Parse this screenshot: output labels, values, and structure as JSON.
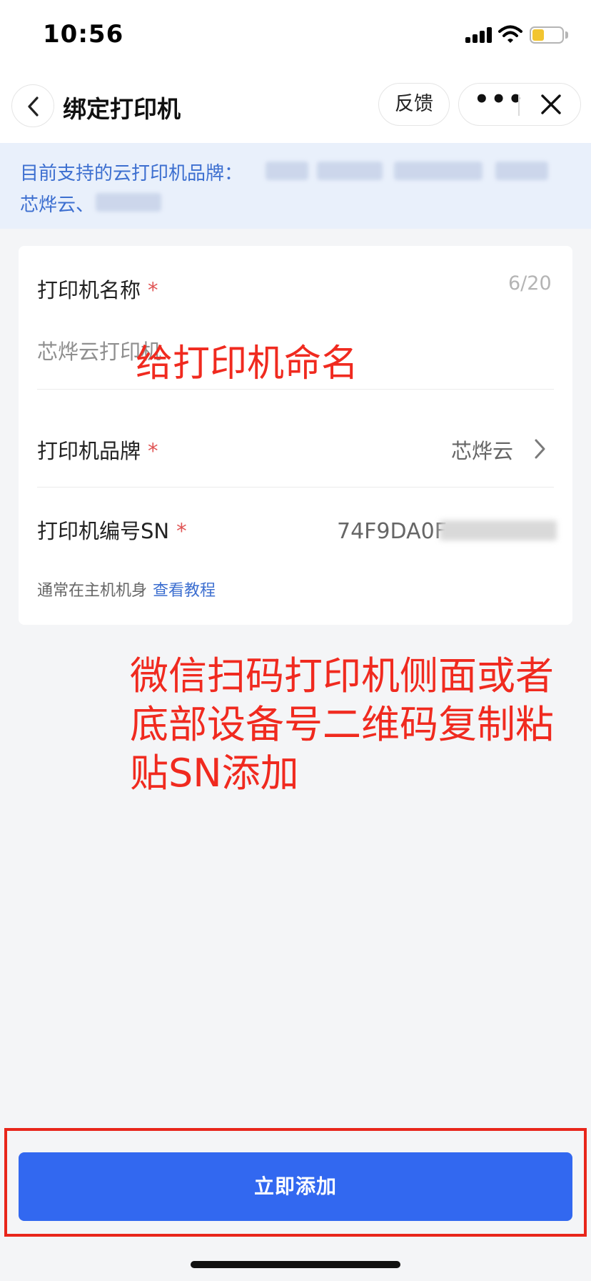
{
  "status_bar": {
    "time": "10:56",
    "battery_level": 0.3,
    "icons": [
      "signal-icon",
      "wifi-icon",
      "battery-icon"
    ]
  },
  "nav": {
    "title": "绑定打印机",
    "feedback_label": "反馈",
    "icons": [
      "back-arrow-icon",
      "more-icon",
      "close-icon"
    ]
  },
  "notice": {
    "line1_prefix": "目前支持的云打印机品牌：",
    "line2_prefix": "芯烨云、"
  },
  "form": {
    "name": {
      "label": "打印机名称",
      "required_mark": "*",
      "counter": "6/20",
      "value": "芯烨云打印机"
    },
    "brand": {
      "label": "打印机品牌",
      "required_mark": "*",
      "value": "芯烨云"
    },
    "sn": {
      "label": "打印机编号SN",
      "required_mark": "*",
      "value": "74F9DA0F"
    },
    "hint": "通常在主机机身",
    "hint_link": "查看教程"
  },
  "annotations": {
    "name_note": "给打印机命名",
    "sn_note": "微信扫码打印机侧面或者底部设备号二维码复制粘贴SN添加"
  },
  "submit_label": "立即添加",
  "colors": {
    "primary": "#3268f0",
    "link": "#3d6fd0",
    "annotation": "#f02a1f",
    "required": "#e05555",
    "notice_bg": "#e9f0fb"
  }
}
